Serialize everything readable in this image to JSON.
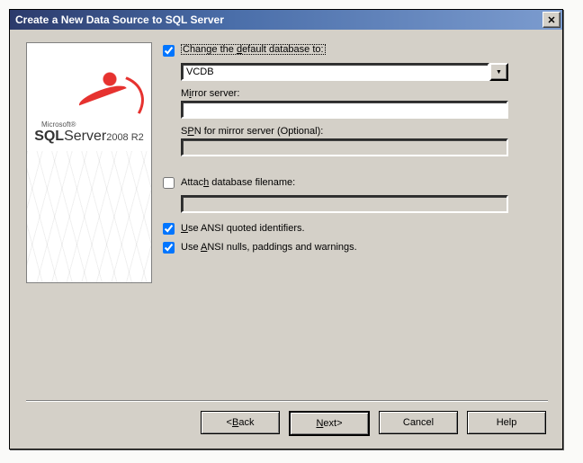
{
  "title": "Create a New Data Source to SQL Server",
  "sidebar_logo": {
    "vendor": "Microsoft®",
    "product_prefix": "SQL",
    "product_word": "Server",
    "version": "2008 R2"
  },
  "form": {
    "change_db": {
      "checked": true,
      "label_pre": "Change the ",
      "label_accel": "d",
      "label_post": "efault database to:",
      "value": "VCDB"
    },
    "mirror": {
      "label_pre": "M",
      "label_accel": "i",
      "label_post": "rror server:",
      "value": ""
    },
    "spn": {
      "label_pre": "S",
      "label_accel": "P",
      "label_post": "N for mirror server (Optional):",
      "value": ""
    },
    "attach": {
      "checked": false,
      "label_pre": "Attac",
      "label_accel": "h",
      "label_post": " database filename:",
      "value": ""
    },
    "ansi_quoted": {
      "checked": true,
      "label_accel": "U",
      "label_rest": "se ANSI quoted identifiers."
    },
    "ansi_nulls": {
      "checked": true,
      "label_pre": "Use ",
      "label_accel": "A",
      "label_post": "NSI nulls, paddings and warnings."
    }
  },
  "buttons": {
    "back_lt": "<",
    "back_sp": " ",
    "back_accel": "B",
    "back_rest": "ack",
    "next_accel": "N",
    "next_rest": "ext ",
    "next_gt": ">",
    "cancel": "Cancel",
    "help": "Help"
  }
}
